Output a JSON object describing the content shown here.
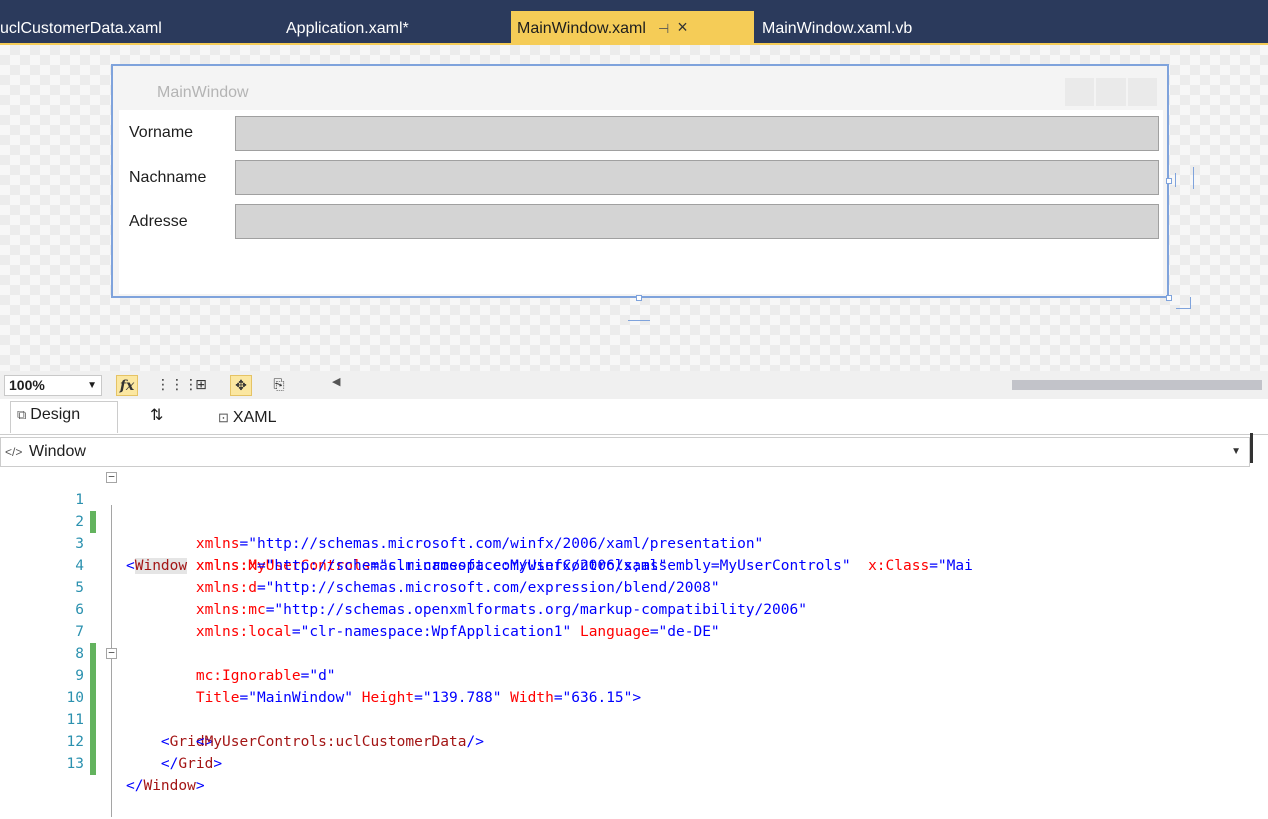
{
  "tabs": [
    {
      "label": "uclCustomerData.xaml",
      "active": false
    },
    {
      "label": "Application.xaml*",
      "active": false
    },
    {
      "label": "MainWindow.xaml",
      "active": true
    },
    {
      "label": "MainWindow.xaml.vb",
      "active": false
    }
  ],
  "designer": {
    "window_title": "MainWindow",
    "fields": [
      {
        "label": "Vorname"
      },
      {
        "label": "Nachname"
      },
      {
        "label": "Adresse"
      }
    ]
  },
  "toolbar": {
    "zoom": "100%",
    "fx_label": "fx"
  },
  "view_tabs": {
    "design": "Design",
    "swap": "⇅",
    "xaml": "XAML"
  },
  "element_combo": {
    "value": "Window"
  },
  "code": {
    "line_numbers": [
      "1",
      "2",
      "3",
      "4",
      "5",
      "6",
      "7",
      "8",
      "9",
      "10",
      "11",
      "12",
      "13"
    ]
  },
  "colors": {
    "tab_strip": "#2b3a5c",
    "active_tab": "#f5cc57",
    "change_bar": "#63b35e",
    "line_number": "#2b91af",
    "xml_element": "#a31515",
    "xml_attribute": "#ff0000",
    "xml_value": "#0000ff"
  }
}
